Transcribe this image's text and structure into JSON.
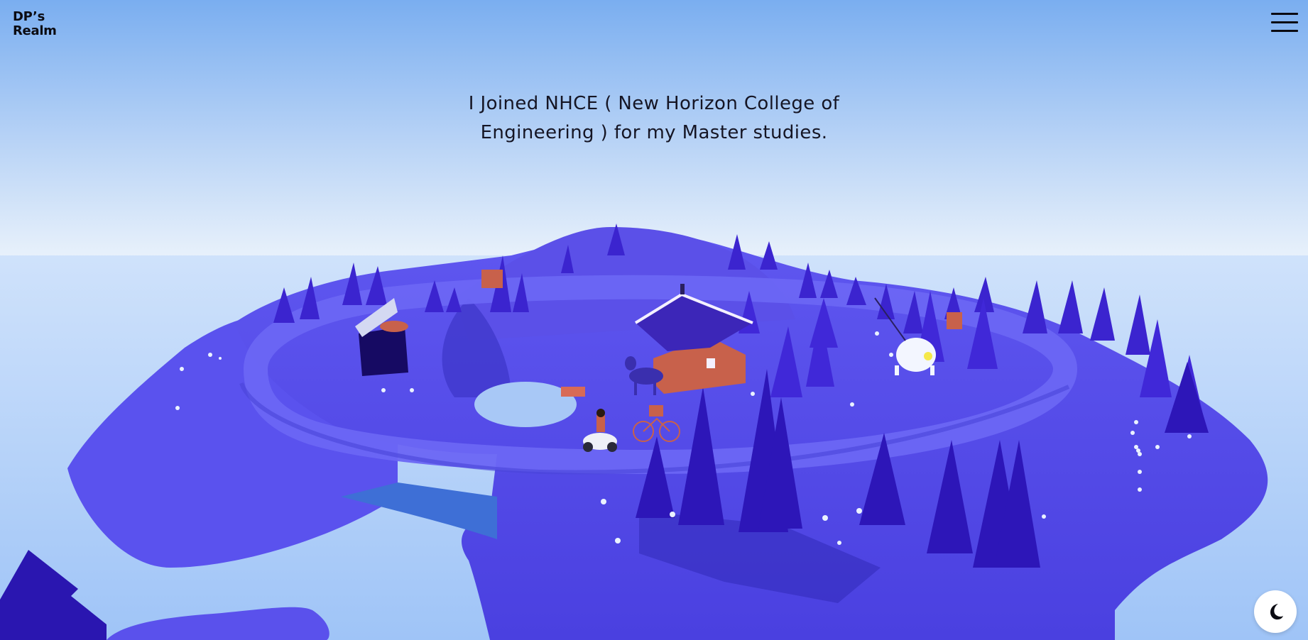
{
  "header": {
    "logo_line1": "DP’s",
    "logo_line2": "Realm",
    "menu_icon": "hamburger-menu-icon"
  },
  "story": {
    "caption_line1": "I Joined NHCE ( New Horizon College of",
    "caption_line2": "Engineering ) for my Master studies."
  },
  "theme_toggle": {
    "icon": "moon-icon",
    "mode": "light"
  },
  "colors": {
    "sky_top": "#7baef0",
    "sky_horizon": "#e6f0fb",
    "ground": "#6159f0",
    "tree": "#3a1fd0",
    "cabin": "#c7614c",
    "text": "#151524"
  }
}
